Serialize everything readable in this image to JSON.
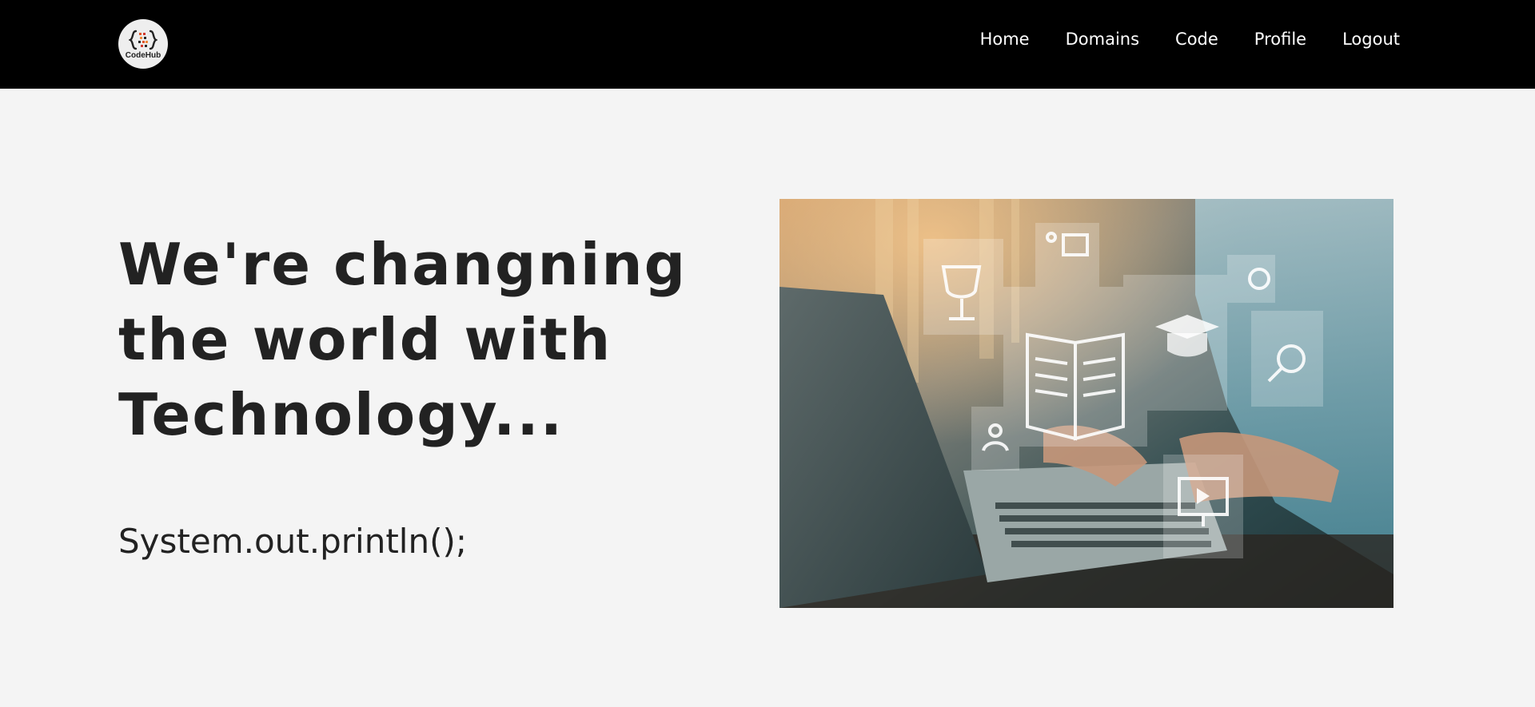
{
  "brand": {
    "logo_text": "CodeHub",
    "logo_icon": "curly-braces-icon"
  },
  "nav": {
    "items": [
      {
        "label": "Home"
      },
      {
        "label": "Domains"
      },
      {
        "label": "Code"
      },
      {
        "label": "Profile"
      },
      {
        "label": "Logout"
      }
    ]
  },
  "hero": {
    "title": "We're changning the world with Technology...",
    "code": "System.out.println();",
    "image_alt": "hands typing on laptop with floating education icons"
  },
  "colors": {
    "navbar_bg": "#000000",
    "page_bg": "#f4f4f4",
    "text": "#222222",
    "nav_text": "#ffffff"
  }
}
